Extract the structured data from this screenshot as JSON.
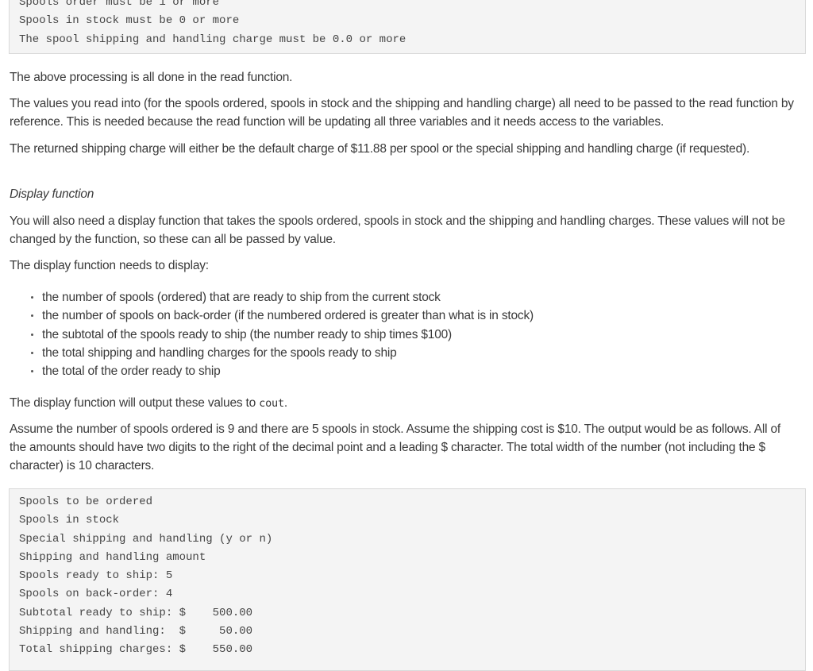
{
  "code_block_top": {
    "lines": [
      "Spools order must be 1 or more",
      "Spools in stock must be 0 or more",
      "The spool shipping and handling charge must be 0.0 or more"
    ]
  },
  "paragraphs": {
    "p1": "The above processing is all done in the read function.",
    "p2": "The values you read into (for the spools ordered, spools in stock and the shipping and handling charge) all need to be passed to the read function by reference. This is needed because the read function will be updating all three variables and it needs access to the variables.",
    "p3": "The returned shipping charge will either be the default charge of $11.88 per spool or the special shipping and handling charge (if requested).",
    "subheading": "Display function",
    "p4": "You will also need a display function that takes the spools ordered, spools in stock and the shipping and handling charges. These values will not be changed by the function, so these can all be passed by value.",
    "p5": "The display function needs to display:",
    "p6_prefix": "The display function will output these values to ",
    "p6_code": "cout",
    "p6_suffix": ".",
    "p7": "Assume the number of spools ordered is 9 and there are 5 spools in stock. Assume the shipping cost is $10. The output would be as follows. All of the amounts should have two digits to the right of the decimal point and a leading $ character. The total width of the number (not including the $ character) is 10 characters."
  },
  "bullets": [
    "the number of spools (ordered) that are ready to ship from the current stock",
    "the number of spools on back-order (if the numbered ordered is greater than what is in stock)",
    "the subtotal of the spools ready to ship (the number ready to ship times $100)",
    "the total shipping and handling charges for the spools ready to ship",
    "the total of the order ready to ship"
  ],
  "code_block_bottom": {
    "lines": [
      "Spools to be ordered",
      "Spools in stock",
      "Special shipping and handling (y or n)",
      "Shipping and handling amount",
      "Spools ready to ship: 5",
      "Spools on back-order: 4",
      "Subtotal ready to ship: $    500.00",
      "Shipping and handling:  $     50.00",
      "Total shipping charges: $    550.00"
    ]
  }
}
